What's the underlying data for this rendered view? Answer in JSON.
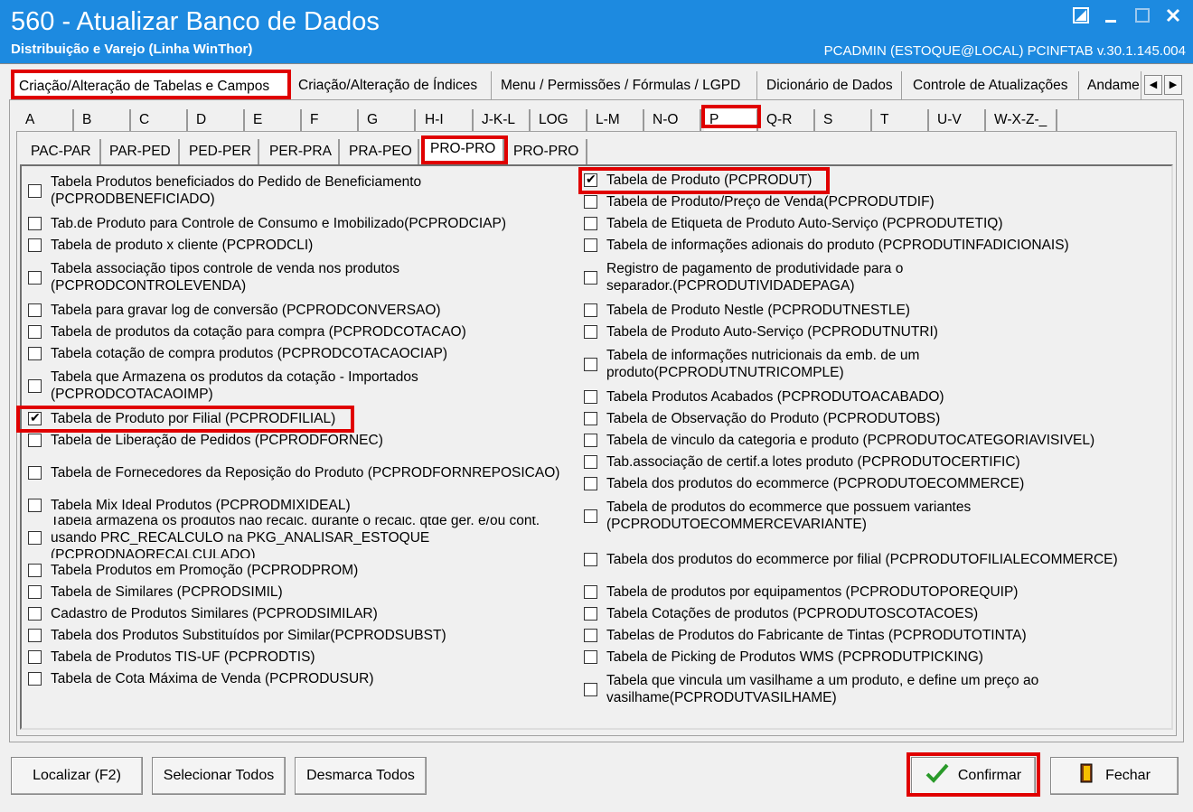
{
  "window": {
    "title": "560 - Atualizar Banco de Dados",
    "subtitle": "Distribuição e Varejo (Linha WinThor)",
    "user_info": "PCADMIN (ESTOQUE@LOCAL)   PCINFTAB  v.30.1.145.004"
  },
  "main_tabs": [
    "Criação/Alteração de Tabelas e Campos",
    "Criação/Alteração de Índices",
    "Menu / Permissões / Fórmulas / LGPD",
    "Dicionário de Dados",
    "Controle de Atualizações",
    "Andame"
  ],
  "letter_tabs": [
    "A",
    "B",
    "C",
    "D",
    "E",
    "F",
    "G",
    "H-I",
    "J-K-L",
    "LOG",
    "L-M",
    "N-O",
    "P",
    "Q-R",
    "S",
    "T",
    "U-V",
    "W-X-Z-_"
  ],
  "sub_tabs": [
    "PAC-PAR",
    "PAR-PED",
    "PED-PER",
    "PER-PRA",
    "PRA-PEO",
    "PRO-PRO",
    "PRO-PRO"
  ],
  "left_items": [
    {
      "label": "Tabela Produtos beneficiados do Pedido de Beneficiamento (PCPRODBENEFICIADO)",
      "checked": false
    },
    {
      "label": "Tab.de Produto para Controle de Consumo e Imobilizado(PCPRODCIAP)",
      "checked": false
    },
    {
      "label": "Tabela de produto x cliente (PCPRODCLI)",
      "checked": false
    },
    {
      "label": "Tabela associação tipos controle de venda nos produtos (PCPRODCONTROLEVENDA)",
      "checked": false
    },
    {
      "label": "Tabela para gravar log de conversão (PCPRODCONVERSAO)",
      "checked": false
    },
    {
      "label": "Tabela de produtos da cotação para compra (PCPRODCOTACAO)",
      "checked": false
    },
    {
      "label": "Tabela cotação de compra produtos (PCPRODCOTACAOCIAP)",
      "checked": false
    },
    {
      "label": "Tabela que Armazena os produtos da cotação - Importados (PCPRODCOTACAOIMP)",
      "checked": false
    },
    {
      "label": "Tabela de Produto por Filial (PCPRODFILIAL)",
      "checked": true
    },
    {
      "label": "Tabela de Liberação de Pedidos (PCPRODFORNEC)",
      "checked": false
    },
    {
      "label": "Tabela de Fornecedores da Reposição do Produto (PCPRODFORNREPOSICAO)",
      "checked": false
    },
    {
      "label": "Tabela Mix Ideal Produtos (PCPRODMIXIDEAL)",
      "checked": false
    },
    {
      "label": "Tabela armazena os produtos não recalc. durante o recalc. qtde ger. e/ou cont. usando PRC_RECALCULO na PKG_ANALISAR_ESTOQUE (PCPRODNAORECALCULADO)",
      "checked": false
    },
    {
      "label": "Tabela Produtos em Promoção (PCPRODPROM)",
      "checked": false
    },
    {
      "label": "Tabela de Similares (PCPRODSIMIL)",
      "checked": false
    },
    {
      "label": "Cadastro de Produtos Similares (PCPRODSIMILAR)",
      "checked": false
    },
    {
      "label": "Tabela dos Produtos Substituídos por Similar(PCPRODSUBST)",
      "checked": false
    },
    {
      "label": "Tabela de Produtos TIS-UF (PCPRODTIS)",
      "checked": false
    },
    {
      "label": "Tabela de Cota Máxima de Venda (PCPRODUSUR)",
      "checked": false
    }
  ],
  "right_items": [
    {
      "label": "Tabela de Produto (PCPRODUT)",
      "checked": true
    },
    {
      "label": "Tabela de Produto/Preço de Venda(PCPRODUTDIF)",
      "checked": false
    },
    {
      "label": "Tabela de Etiqueta de Produto Auto-Serviço (PCPRODUTETIQ)",
      "checked": false
    },
    {
      "label": "Tabela de informações adionais do produto (PCPRODUTINFADICIONAIS)",
      "checked": false
    },
    {
      "label": "Registro de pagamento de produtividade para o separador.(PCPRODUTIVIDADEPAGA)",
      "checked": false
    },
    {
      "label": "Tabela de Produto Nestle (PCPRODUTNESTLE)",
      "checked": false
    },
    {
      "label": "Tabela de Produto Auto-Serviço (PCPRODUTNUTRI)",
      "checked": false
    },
    {
      "label": "Tabela de informações nutricionais da emb. de um produto(PCPRODUTNUTRICOMPLE)",
      "checked": false
    },
    {
      "label": "Tabela Produtos Acabados (PCPRODUTOACABADO)",
      "checked": false
    },
    {
      "label": "Tabela de Observação do Produto (PCPRODUTOBS)",
      "checked": false
    },
    {
      "label": "Tabela de vinculo da categoria e produto (PCPRODUTOCATEGORIAVISIVEL)",
      "checked": false
    },
    {
      "label": "Tab.associação de certif.a lotes produto (PCPRODUTOCERTIFIC)",
      "checked": false
    },
    {
      "label": "Tabela dos produtos do ecommerce (PCPRODUTOECOMMERCE)",
      "checked": false
    },
    {
      "label": "Tabela de produtos do ecommerce que possuem variantes (PCPRODUTOECOMMERCEVARIANTE)",
      "checked": false
    },
    {
      "label": "Tabela dos produtos do ecommerce por filial (PCPRODUTOFILIALECOMMERCE)",
      "checked": false
    },
    {
      "label": "Tabela de produtos por equipamentos (PCPRODUTOPOREQUIP)",
      "checked": false
    },
    {
      "label": "Tabela Cotações de produtos (PCPRODUTOSCOTACOES)",
      "checked": false
    },
    {
      "label": "Tabelas de Produtos do Fabricante de Tintas (PCPRODUTOTINTA)",
      "checked": false
    },
    {
      "label": "Tabela de Picking de Produtos WMS (PCPRODUTPICKING)",
      "checked": false
    },
    {
      "label": "Tabela que vincula um vasilhame a um produto, e define um preço ao vasilhame(PCPRODUTVASILHAME)",
      "checked": false
    }
  ],
  "buttons": {
    "localizar": "Localizar (F2)",
    "selecionar": "Selecionar Todos",
    "desmarca": "Desmarca Todos",
    "confirmar": "Confirmar",
    "fechar": "Fechar"
  },
  "colors": {
    "titlebar": "#1d8ae0",
    "highlight": "#e00000",
    "confirm_icon": "#2a9a2a"
  }
}
